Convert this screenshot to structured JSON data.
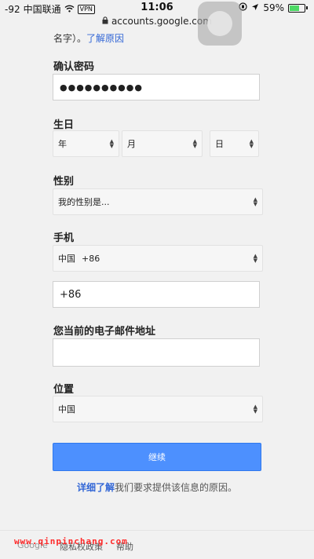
{
  "status_bar": {
    "signal": "-92",
    "carrier": "中国联通",
    "vpn": "VPN",
    "time": "11:06",
    "url": "accounts.google.com",
    "battery": "59%",
    "battery_level": 0.59,
    "battery_color": "#4cd964"
  },
  "hint": {
    "prefix": "名字）。",
    "link": "了解原因"
  },
  "confirm_password": {
    "label": "确认密码",
    "value": "●●●●●●●●●●"
  },
  "birthday": {
    "label": "生日",
    "year_placeholder": "年",
    "month_placeholder": "月",
    "day_placeholder": "日"
  },
  "gender": {
    "label": "性别",
    "selected": "我的性别是..."
  },
  "phone": {
    "label": "手机",
    "country": "中国",
    "country_code": "+86",
    "number_value": "+86"
  },
  "current_email": {
    "label": "您当前的电子邮件地址",
    "value": ""
  },
  "location": {
    "label": "位置",
    "selected": "中国"
  },
  "continue_button": {
    "label": "继续",
    "color": "#4d90fe"
  },
  "why_text": {
    "link": "详细了解",
    "text": "我们要求提供该信息的原因。"
  },
  "footer": {
    "brand": "Google",
    "privacy": "隐私权政策",
    "help": "帮助"
  },
  "watermark": {
    "text": "www.qinpinchang.com"
  }
}
